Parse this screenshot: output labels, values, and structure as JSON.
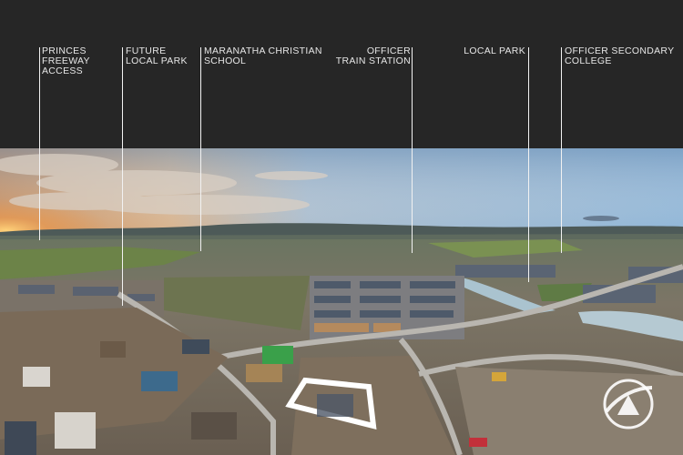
{
  "callouts": [
    {
      "id": "princes-freeway",
      "text": "PRINCES\nFREEWAY\nACCESS",
      "align": "left"
    },
    {
      "id": "future-local-park",
      "text": "FUTURE\nLOCAL PARK",
      "align": "left"
    },
    {
      "id": "maranatha-school",
      "text": "MARANATHA CHRISTIAN\nSCHOOL",
      "align": "left"
    },
    {
      "id": "officer-station",
      "text": "OFFICER\nTRAIN STATION",
      "align": "right"
    },
    {
      "id": "local-park",
      "text": "LOCAL PARK",
      "align": "right"
    },
    {
      "id": "officer-secondary",
      "text": "OFFICER SECONDARY\nCOLLEGE",
      "align": "left"
    }
  ],
  "colors": {
    "header": "#262626",
    "label": "#e6e6e6",
    "highlight": "#ffffff"
  },
  "icons": [
    "compass-logo-icon"
  ]
}
